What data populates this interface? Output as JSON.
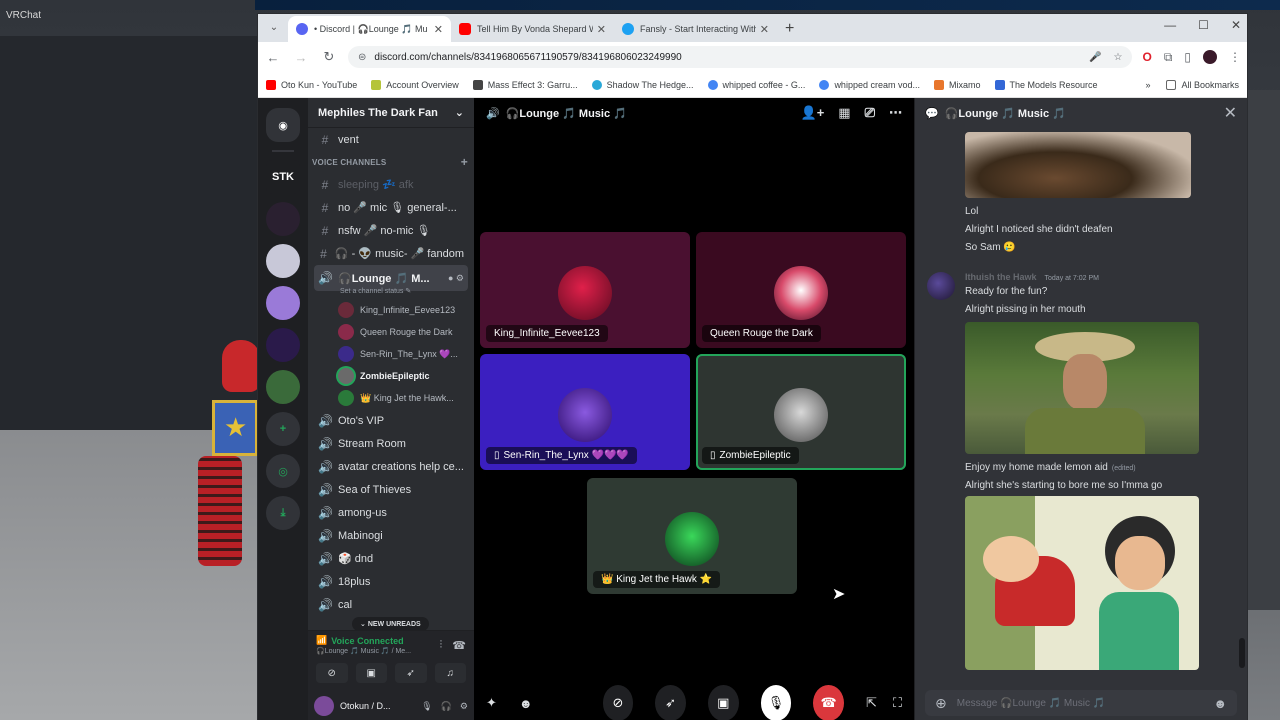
{
  "vrchat": {
    "title": "VRChat"
  },
  "browser": {
    "tabs": [
      {
        "label": "• Discord | 🎧Lounge 🎵 Mu",
        "color": "#5865f2"
      },
      {
        "label": "Tell Him By Vonda Shepard Wit",
        "color": "#ff0000"
      },
      {
        "label": "Fansly - Start Interacting With",
        "color": "#1da1f2"
      }
    ],
    "url": "discord.com/channels/834196806567119057​9/834196806023249990",
    "bookmarks": [
      {
        "label": "Oto Kun - YouTube",
        "color": "#ff0000"
      },
      {
        "label": "Account Overview",
        "color": "#b5c43a"
      },
      {
        "label": "Mass Effect 3: Garru...",
        "color": "#444444"
      },
      {
        "label": "Shadow The Hedge...",
        "color": "#2aa8d8"
      },
      {
        "label": "whipped coffee - G...",
        "color": "#4285f4"
      },
      {
        "label": "whipped cream vod...",
        "color": "#4285f4"
      },
      {
        "label": "Mixamo",
        "color": "#e8762c"
      },
      {
        "label": "The Models Resource",
        "color": "#3367d6"
      }
    ],
    "all_bookmarks": "All Bookmarks"
  },
  "servers": [
    "STK"
  ],
  "guild": {
    "name": "Mephiles The Dark Fan",
    "top_channel": "vent",
    "category": "VOICE CHANNELS",
    "channels": [
      {
        "label": "sleeping 💤 afk",
        "style": "dim"
      },
      {
        "label": "no 🎤 mic 🎙 general-...",
        "style": "bright"
      },
      {
        "label": "nsfw 🎤 no-mic 🎙",
        "style": "bright"
      },
      {
        "label": "🎧 - 👽 music- 🎤 fandom",
        "style": "bright"
      }
    ],
    "active_channel": "🎧Lounge 🎵 M...",
    "active_status": "Set a channel status ✎",
    "voice_users": [
      {
        "name": "King_Infinite_Eevee123",
        "color": "#6a2a3a",
        "speaking": false
      },
      {
        "name": "Queen Rouge the Dark",
        "color": "#8a2a4a",
        "speaking": false
      },
      {
        "name": "Sen-Rin_The_Lynx 💜...",
        "color": "#3b2a8a",
        "speaking": false
      },
      {
        "name": "ZombieEpileptic",
        "color": "#6a6a6a",
        "speaking": true
      },
      {
        "name": "👑 King Jet the Hawk...",
        "color": "#2a7a3a",
        "speaking": false
      }
    ],
    "more_channels": [
      "Oto's VIP",
      "Stream Room",
      "avatar creations help ce...",
      "Sea of Thieves",
      "among-us",
      "Mabinogi",
      "🎲 dnd",
      "18plus",
      "cal"
    ],
    "new_unreads": "NEW UNREADS",
    "voice_connected": "Voice Connected",
    "voice_sub": "🎧Lounge 🎵 Music 🎵 / Me...",
    "user": "Otokun / D..."
  },
  "stage": {
    "title": "🎧Lounge 🎵 Music 🎵",
    "tiles": [
      {
        "name": "King_Infinite_Eevee123",
        "bg": "#4a1030",
        "av": "#8a1a2a"
      },
      {
        "name": "Queen Rouge the Dark",
        "bg": "#3a0a20",
        "av": "#d84a6a"
      },
      {
        "name": "Sen-Rin_The_Lynx 💜💜💜",
        "bg": "#3b1fc0",
        "av": "#5a2ab8"
      },
      {
        "name": "ZombieEpileptic",
        "bg": "#2e3531",
        "av": "#8a8a8a"
      },
      {
        "name": "👑 King Jet the Hawk ⭐",
        "bg": "#2f3a33",
        "av": "#2aa84a"
      }
    ]
  },
  "chat": {
    "title": "🎧Lounge 🎵 Music 🎵",
    "messages_top": [
      "Lol",
      "Alright I noticed she didn't deafen",
      "So Sam 🥲"
    ],
    "author": "Ithuish the Hawk",
    "time": "Today at 7:02 PM",
    "messages_mid": [
      "Ready for the fun?",
      "Alright pissing in her mouth"
    ],
    "msg_edited_text": "Enjoy my home made lemon aid",
    "edited_label": "(edited)",
    "msg_last": "Alright she's starting to bore me so I'mma go",
    "composer_placeholder": "Message 🎧Lounge 🎵 Music 🎵"
  }
}
